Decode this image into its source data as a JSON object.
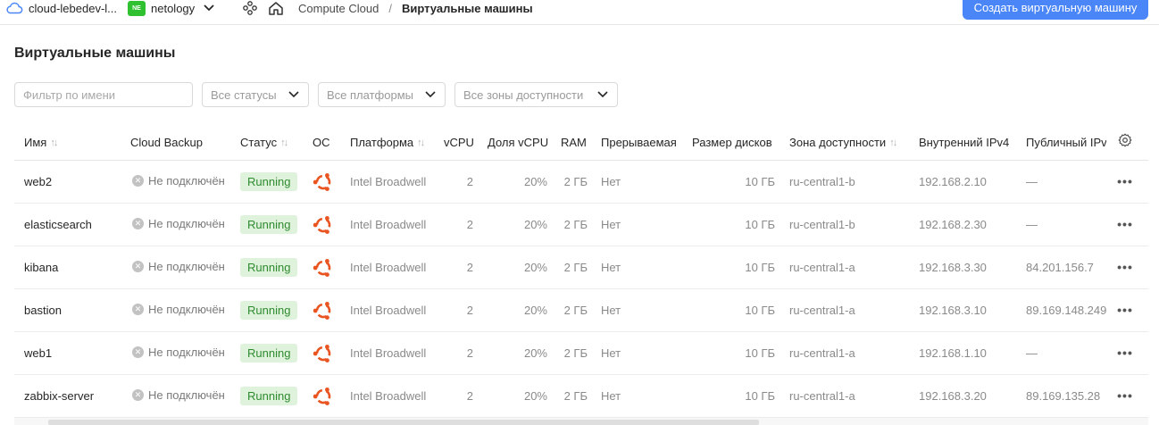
{
  "topbar": {
    "cloud_name": "cloud-lebedev-l...",
    "folder_badge": "NE",
    "folder_name": "netology",
    "breadcrumbs": [
      "Compute Cloud",
      "Виртуальные машины"
    ],
    "create_button": "Создать виртуальную машину",
    "accent_color": "#4a86f7"
  },
  "page": {
    "title": "Виртуальные машины"
  },
  "filters": {
    "name_placeholder": "Фильтр по имени",
    "status": "Все статусы",
    "platform": "Все платформы",
    "zone": "Все зоны доступности"
  },
  "table": {
    "columns": {
      "name": "Имя",
      "backup": "Cloud Backup",
      "status": "Статус",
      "os": "ОС",
      "platform": "Платформа",
      "vcpu": "vCPU",
      "vcpu_share": "Доля vCPU",
      "ram": "RAM",
      "preemptible": "Прерываемая",
      "disk": "Размер дисков",
      "zone": "Зона доступности",
      "internal_ip": "Внутренний IPv4",
      "public_ip": "Публичный IPv"
    },
    "rows": [
      {
        "name": "web2",
        "backup": "Не подключён",
        "status": "Running",
        "os": "ubuntu-icon",
        "platform": "Intel Broadwell",
        "vcpu": "2",
        "vcpu_share": "20%",
        "ram": "2 ГБ",
        "preemptible": "Нет",
        "disk": "10 ГБ",
        "zone": "ru-central1-b",
        "internal_ip": "192.168.2.10",
        "public_ip": "—"
      },
      {
        "name": "elasticsearch",
        "backup": "Не подключён",
        "status": "Running",
        "os": "ubuntu-icon",
        "platform": "Intel Broadwell",
        "vcpu": "2",
        "vcpu_share": "20%",
        "ram": "2 ГБ",
        "preemptible": "Нет",
        "disk": "10 ГБ",
        "zone": "ru-central1-b",
        "internal_ip": "192.168.2.30",
        "public_ip": "—"
      },
      {
        "name": "kibana",
        "backup": "Не подключён",
        "status": "Running",
        "os": "ubuntu-icon",
        "platform": "Intel Broadwell",
        "vcpu": "2",
        "vcpu_share": "20%",
        "ram": "2 ГБ",
        "preemptible": "Нет",
        "disk": "10 ГБ",
        "zone": "ru-central1-a",
        "internal_ip": "192.168.3.30",
        "public_ip": "84.201.156.7"
      },
      {
        "name": "bastion",
        "backup": "Не подключён",
        "status": "Running",
        "os": "ubuntu-icon",
        "platform": "Intel Broadwell",
        "vcpu": "2",
        "vcpu_share": "20%",
        "ram": "2 ГБ",
        "preemptible": "Нет",
        "disk": "10 ГБ",
        "zone": "ru-central1-a",
        "internal_ip": "192.168.3.10",
        "public_ip": "89.169.148.249"
      },
      {
        "name": "web1",
        "backup": "Не подключён",
        "status": "Running",
        "os": "ubuntu-icon",
        "platform": "Intel Broadwell",
        "vcpu": "2",
        "vcpu_share": "20%",
        "ram": "2 ГБ",
        "preemptible": "Нет",
        "disk": "10 ГБ",
        "zone": "ru-central1-a",
        "internal_ip": "192.168.1.10",
        "public_ip": "—"
      },
      {
        "name": "zabbix-server",
        "backup": "Не подключён",
        "status": "Running",
        "os": "ubuntu-icon",
        "platform": "Intel Broadwell",
        "vcpu": "2",
        "vcpu_share": "20%",
        "ram": "2 ГБ",
        "preemptible": "Нет",
        "disk": "10 ГБ",
        "zone": "ru-central1-a",
        "internal_ip": "192.168.3.20",
        "public_ip": "89.169.135.28"
      }
    ],
    "status_color": "#2f8a2f",
    "os_color": "#e95420"
  }
}
